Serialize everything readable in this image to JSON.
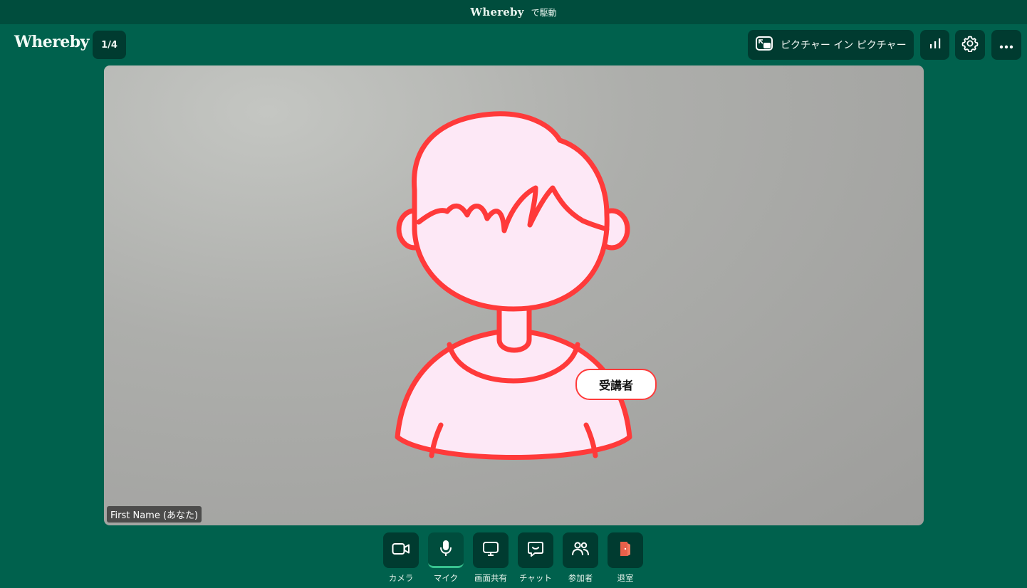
{
  "titlebar": {
    "brand": "Whereby",
    "suffix": "で駆動"
  },
  "header": {
    "logo": "Whereby",
    "room_count": "1/4",
    "pip_label": "ピクチャー イン ピクチャー"
  },
  "video": {
    "participant_name": "First Name (あなた)",
    "role_badge": "受講者"
  },
  "controls": [
    {
      "label": "カメラ",
      "icon": "camera-icon"
    },
    {
      "label": "マイク",
      "icon": "microphone-icon",
      "active": true
    },
    {
      "label": "画面共有",
      "icon": "screen-share-icon"
    },
    {
      "label": "チャット",
      "icon": "chat-icon"
    },
    {
      "label": "参加者",
      "icon": "participants-icon"
    },
    {
      "label": "退室",
      "icon": "leave-door-icon"
    }
  ],
  "colors": {
    "background": "#00614d",
    "titlebar": "#004d3d",
    "button": "#003b30",
    "avatar_stroke": "#ff3a3a",
    "avatar_fill": "#fde8f6",
    "leave": "#e8604a"
  }
}
